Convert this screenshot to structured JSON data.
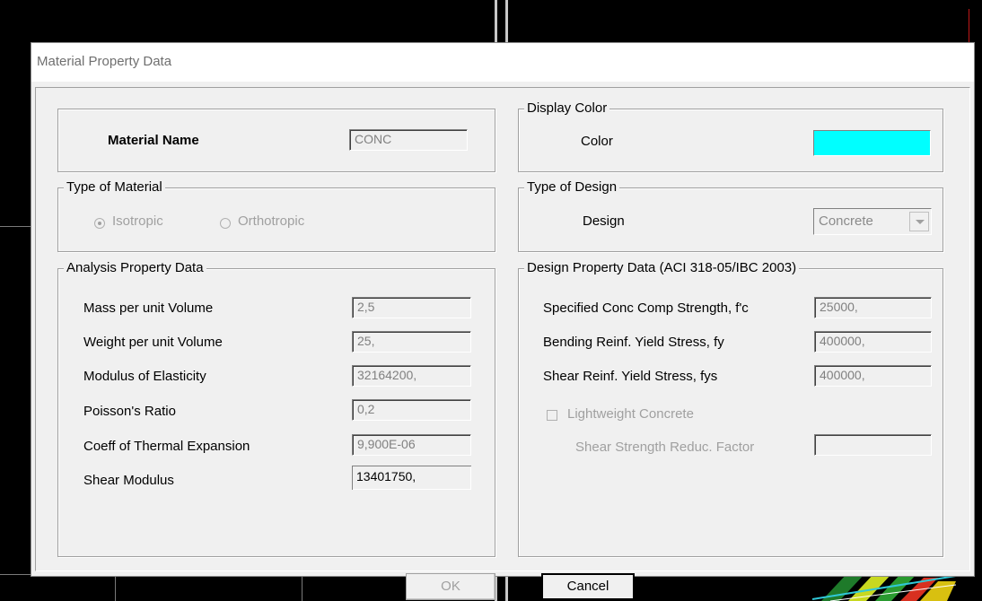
{
  "window": {
    "title": "Material Property Data"
  },
  "material_name": {
    "label": "Material Name",
    "value": "CONC"
  },
  "display_color": {
    "group_label": "Display Color",
    "label": "Color",
    "swatch_color": "#00ffff"
  },
  "type_of_material": {
    "group_label": "Type of Material",
    "options": [
      {
        "label": "Isotropic",
        "selected": true
      },
      {
        "label": "Orthotropic",
        "selected": false
      }
    ]
  },
  "type_of_design": {
    "group_label": "Type of Design",
    "label": "Design",
    "value": "Concrete"
  },
  "analysis": {
    "group_label": "Analysis Property Data",
    "rows": [
      {
        "label": "Mass per unit Volume",
        "value": "2,5"
      },
      {
        "label": "Weight per unit Volume",
        "value": "25,"
      },
      {
        "label": "Modulus of Elasticity",
        "value": "32164200,"
      },
      {
        "label": "Poisson's Ratio",
        "value": "0,2"
      },
      {
        "label": "Coeff of Thermal Expansion",
        "value": "9,900E-06"
      },
      {
        "label": "Shear Modulus",
        "value": "13401750,"
      }
    ]
  },
  "design": {
    "group_label": "Design Property Data (ACI 318-05/IBC 2003)",
    "rows": [
      {
        "label": "Specified Conc Comp Strength, f'c",
        "value": "25000,"
      },
      {
        "label": "Bending Reinf. Yield Stress, fy",
        "value": "400000,"
      },
      {
        "label": "Shear Reinf. Yield Stress, fys",
        "value": "400000,"
      }
    ],
    "lightweight_label": "Lightweight Concrete",
    "shear_reduc_label": "Shear Strength Reduc. Factor",
    "shear_reduc_value": ""
  },
  "buttons": {
    "ok": "OK",
    "cancel": "Cancel"
  }
}
